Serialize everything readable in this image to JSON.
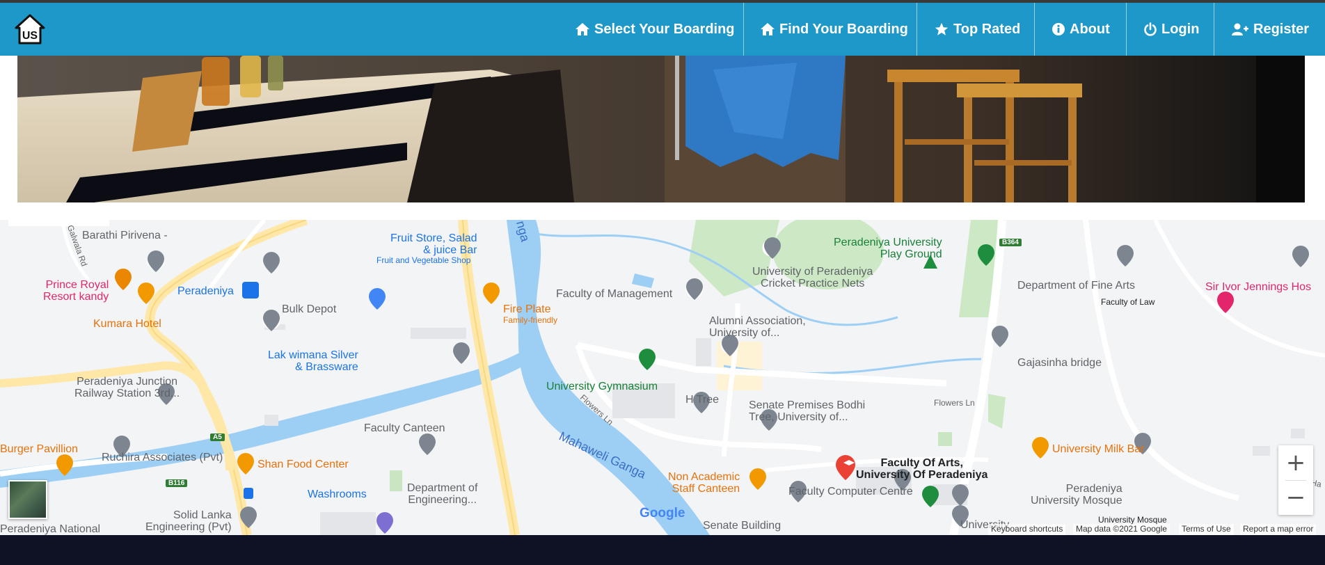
{
  "navbar": {
    "logo_text": "US",
    "items": [
      {
        "label": "Select Your Boarding",
        "icon": "home-icon"
      },
      {
        "label": "Find Your Boarding",
        "icon": "home-icon"
      },
      {
        "label": "Top Rated",
        "icon": "star-icon"
      },
      {
        "label": "About",
        "icon": "info-icon"
      },
      {
        "label": "Login",
        "icon": "power-icon"
      },
      {
        "label": "Register",
        "icon": "user-plus-icon"
      }
    ]
  },
  "map": {
    "pois": [
      {
        "label": "Barathi Pirivena -",
        "style": "gray"
      },
      {
        "label": "Prince Royal\nResort kandy",
        "style": "pink"
      },
      {
        "label": "Kumara Hotel",
        "style": "orange"
      },
      {
        "label": "Peradeniya",
        "style": "blue"
      },
      {
        "label": "Bulk Depot",
        "style": "gray"
      },
      {
        "label": "Fruit Store, Salad\n& juice Bar",
        "style": "blue"
      },
      {
        "label": "Fruit and Vegetable Shop",
        "style": "blue"
      },
      {
        "label": "Fire Plate",
        "style": "orange"
      },
      {
        "label": "Family-friendly",
        "style": "orange"
      },
      {
        "label": "Lak wimana Silver\n& Brassware",
        "style": "blue"
      },
      {
        "label": "Peradeniya Junction\nRailway Station 3rd...",
        "style": "gray"
      },
      {
        "label": "Burger Pavillion",
        "style": "orange"
      },
      {
        "label": "Ruchira Associates (Pvt)",
        "style": "gray"
      },
      {
        "label": "Shan Food Center",
        "style": "orange"
      },
      {
        "label": "Faculty Canteen",
        "style": "gray"
      },
      {
        "label": "Washrooms",
        "style": "blue"
      },
      {
        "label": "Department of\nEngineering...",
        "style": "gray"
      },
      {
        "label": "Solid Lanka\nEngineering (Pvt)",
        "style": "gray"
      },
      {
        "label": "Peradeniya National",
        "style": "gray"
      },
      {
        "label": "Faculty of Management",
        "style": "gray"
      },
      {
        "label": "University of Peradeniya\nCricket Practice Nets",
        "style": "gray"
      },
      {
        "label": "Peradeniya University\nPlay Ground",
        "style": "green"
      },
      {
        "label": "Alumni Association,\nUniversity of...",
        "style": "gray"
      },
      {
        "label": "University Gymnasium",
        "style": "green"
      },
      {
        "label": "H Tree",
        "style": "gray"
      },
      {
        "label": "Senate Premises Bodhi\nTree, University of...",
        "style": "gray"
      },
      {
        "label": "Non Academic\nStaff Canteen",
        "style": "orange"
      },
      {
        "label": "Faculty Of Arts,\nUniversity Of Peradeniya",
        "style": "dark"
      },
      {
        "label": "Faculty Computer Centre",
        "style": "gray"
      },
      {
        "label": "Senate Building",
        "style": "gray"
      },
      {
        "label": "Department of Fine Arts",
        "style": "gray"
      },
      {
        "label": "Faculty of Law",
        "style": "dark"
      },
      {
        "label": "Sir Ivor Jennings Hos",
        "style": "pink"
      },
      {
        "label": "Gajasinha bridge",
        "style": "gray"
      },
      {
        "label": "University Milk Bar",
        "style": "orange"
      },
      {
        "label": "Peradeniya\nUniversity Mosque",
        "style": "gray"
      },
      {
        "label": "University Mosque",
        "style": "dark"
      },
      {
        "label": "University",
        "style": "gray"
      }
    ],
    "roads": [
      "Galwala Rd",
      "Flowers Ln",
      "Flowers Ln",
      "Upper Ha"
    ],
    "river": "Mahaweli Ganga",
    "river_top": "nga",
    "shields": [
      "A5",
      "B116",
      "B364"
    ],
    "google_logo": "Google",
    "attribution": [
      "Keyboard shortcuts",
      "Map data ©2021 Google",
      "Terms of Use",
      "Report a map error"
    ],
    "zoom_in": "+",
    "zoom_out": "−"
  }
}
